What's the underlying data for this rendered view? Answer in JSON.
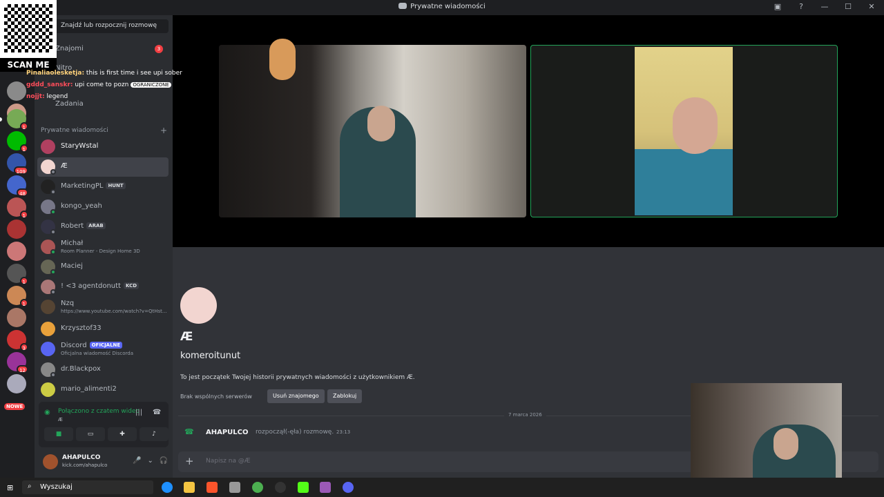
{
  "window": {
    "title": "Prywatne wiadomości"
  },
  "window_controls": [
    "inbox-icon",
    "help-icon",
    "minimize-icon",
    "maximize-icon",
    "close-icon"
  ],
  "servers": {
    "badges": [
      "1",
      "1",
      "109",
      "48",
      "1",
      "1",
      "1",
      "3",
      "12"
    ],
    "new_label": "NOWE"
  },
  "channels": {
    "search_placeholder": "Znajdź lub rozpocznij rozmowę",
    "nav": {
      "friends": "Znajomi",
      "friends_badge": "3",
      "nitro": "Nitro",
      "quests": "Zadania"
    },
    "dm_header": "Prywatne wiadomości",
    "dms": [
      {
        "name": "StaryWstal",
        "status": "",
        "tag": ""
      },
      {
        "name": "Æ",
        "status": "",
        "tag": ""
      },
      {
        "name": "MarketingPL",
        "status": "",
        "tag": "HUNT"
      },
      {
        "name": "kongo_yeah",
        "status": "",
        "tag": ""
      },
      {
        "name": "Robert",
        "status": "",
        "tag": "ARAB"
      },
      {
        "name": "Michał",
        "status": "Room Planner - Design Home 3D",
        "tag": ""
      },
      {
        "name": "Maciej",
        "status": "",
        "tag": ""
      },
      {
        "name": "! <3 agentdonutt",
        "status": "",
        "tag": "KCD"
      },
      {
        "name": "Nzq",
        "status": "https://www.youtube.com/watch?v=QtHst...",
        "tag": ""
      },
      {
        "name": "Krzysztof33",
        "status": "",
        "tag": ""
      },
      {
        "name": "Discord",
        "status": "Oficjalna wiadomość Discorda",
        "tag": "OFICJALNE"
      },
      {
        "name": "dr.Blackpox",
        "status": "",
        "tag": ""
      },
      {
        "name": "mario_alimenti2",
        "status": "",
        "tag": ""
      }
    ]
  },
  "voice": {
    "title": "Połączono z czatem wideo",
    "subtitle": "Æ"
  },
  "user": {
    "name": "AHAPULCO",
    "status": "kick.com/ahapulco"
  },
  "profile": {
    "display_name": "Æ",
    "username": "komeroitunut",
    "intro": "To jest początek Twojej historii prywatnych wiadomości z użytkownikiem Æ.",
    "no_servers": "Brak wspólnych serwerów",
    "remove_friend": "Usuń znajomego",
    "block": "Zablokuj"
  },
  "messages": {
    "date": "7 marca 2026",
    "call": {
      "user": "AHAPULCO",
      "text": "rozpoczął(-ęła) rozmowę.",
      "time": "23:13"
    }
  },
  "composer": {
    "placeholder": "Napisz na @Æ"
  },
  "overlay": {
    "qr_label": "SCAN ME",
    "chat": [
      {
        "user": "Pinaliaolesketja:",
        "text": "this is first time i see upi sober",
        "label": ""
      },
      {
        "user": "gddd_sanskr:",
        "text": "upi come to pozn",
        "label": "OGRANICZONE"
      },
      {
        "user": "nojjt:",
        "text": "legend",
        "label": ""
      }
    ]
  },
  "taskbar": {
    "search": "Wyszukaj"
  }
}
